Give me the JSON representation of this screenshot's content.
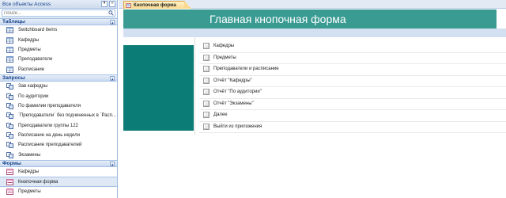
{
  "nav": {
    "title": "Все объекты Access",
    "search_placeholder": "Поиск...",
    "groups": [
      {
        "label": "Таблицы",
        "items": [
          {
            "label": "Switchboard Items",
            "icon": "table-icon"
          },
          {
            "label": "Кафедры",
            "icon": "table-icon"
          },
          {
            "label": "Предметы",
            "icon": "table-icon"
          },
          {
            "label": "Преподаватели",
            "icon": "table-icon"
          },
          {
            "label": "Расписание",
            "icon": "table-icon"
          }
        ]
      },
      {
        "label": "Запросы",
        "items": [
          {
            "label": "Зав кафедры",
            "icon": "query-icon"
          },
          {
            "label": "По аудитории",
            "icon": "query-icon"
          },
          {
            "label": "По фамилии преподавателя",
            "icon": "query-icon"
          },
          {
            "label": "`Преподаватели` без подчиненных в `Расп...",
            "icon": "query-icon"
          },
          {
            "label": "Преподаватели группы 122",
            "icon": "query-icon"
          },
          {
            "label": "Расписание на день недели",
            "icon": "query-icon"
          },
          {
            "label": "Расписание преподавателей",
            "icon": "query-icon"
          },
          {
            "label": "Экзамены",
            "icon": "query-icon"
          }
        ]
      },
      {
        "label": "Формы",
        "items": [
          {
            "label": "Кафедры",
            "icon": "form-icon"
          },
          {
            "label": "Кнопочная форма",
            "icon": "form-icon",
            "selected": true
          },
          {
            "label": "Предметы",
            "icon": "form-icon"
          }
        ]
      }
    ]
  },
  "doc": {
    "tab_label": "Кнопочная форма",
    "banner_title": "Главная кнопочная форма",
    "buttons": [
      "Кафедры",
      "Предметы",
      "Преподаватели и расписание",
      "Отчёт \"Кафедры\"",
      "Отчёт \"По аудитории\"",
      "Отчёт \"Экзамены\"",
      "Далее",
      "Выйти из приложения"
    ]
  },
  "colors": {
    "banner": "#3a9b93",
    "side_block": "#0c7c76",
    "band": "#d3e0f1",
    "nav_header_text": "#15428b",
    "tab_active": "#fbd88d"
  }
}
